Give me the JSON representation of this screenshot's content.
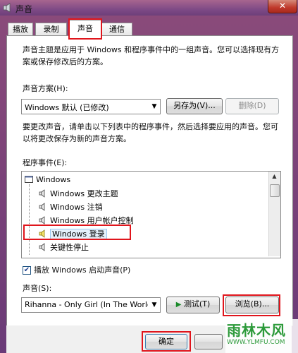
{
  "window": {
    "title": "声音",
    "close_glyph": "✕"
  },
  "tabs": [
    {
      "label": "播放"
    },
    {
      "label": "录制"
    },
    {
      "label": "声音"
    },
    {
      "label": "通信"
    }
  ],
  "intro_text": "声音主题是应用于 Windows 和程序事件中的一组声音。您可以选择现有方案或保存修改后的方案。",
  "scheme": {
    "label": "声音方案(H):",
    "value": "Windows 默认 (已修改)",
    "save_as_label": "另存为(V)...",
    "delete_label": "删除(D)"
  },
  "change_text": "要更改声音，请单击以下列表中的程序事件，然后选择要应用的声音。您可以将更改保存为新的声音方案。",
  "events": {
    "label": "程序事件(E):",
    "items": [
      {
        "label": "Windows"
      },
      {
        "label": "Windows 更改主题"
      },
      {
        "label": "Windows 注销"
      },
      {
        "label": "Windows 用户帐户控制"
      },
      {
        "label": "Windows 登录"
      },
      {
        "label": "关键性停止"
      }
    ]
  },
  "startup_sound": {
    "label": "播放 Windows 启动声音(P)",
    "checked": true
  },
  "sound": {
    "label": "声音(S):",
    "value": "Rihanna - Only Girl (In The World)",
    "test_label": "测试(T)",
    "browse_label": "浏览(B)..."
  },
  "footer": {
    "ok_label": "确定"
  },
  "watermark": {
    "line1": "雨林木风",
    "line2": "WWW.YLMFU.COM"
  }
}
